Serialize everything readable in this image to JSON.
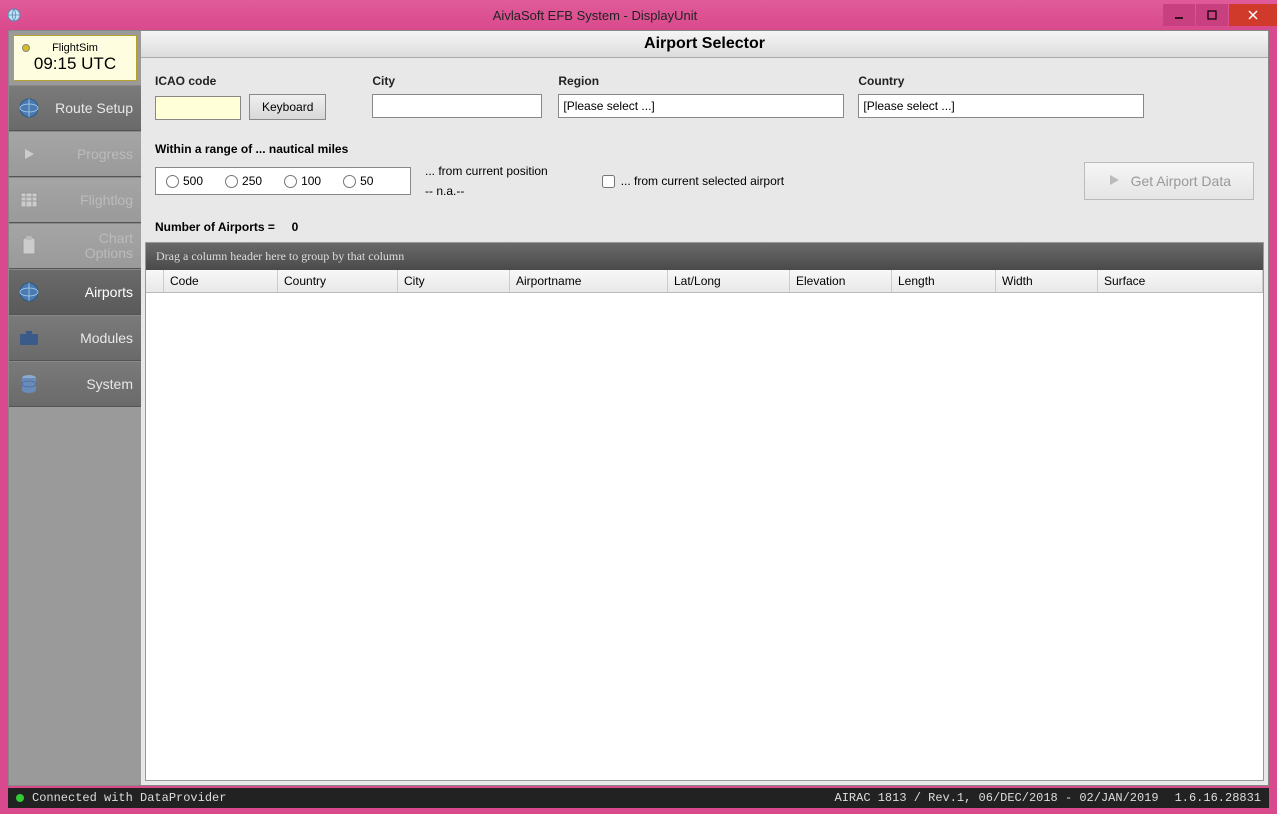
{
  "window": {
    "title": "AivlaSoft EFB System - DisplayUnit"
  },
  "clock": {
    "label": "FlightSim",
    "time": "09:15 UTC"
  },
  "nav": {
    "items": [
      {
        "label": "Route Setup",
        "enabled": true,
        "active": false,
        "icon": "globe"
      },
      {
        "label": "Progress",
        "enabled": false,
        "active": false,
        "icon": "play"
      },
      {
        "label": "Flightlog",
        "enabled": false,
        "active": false,
        "icon": "grid"
      },
      {
        "label": "Chart Options",
        "enabled": false,
        "active": false,
        "icon": "clipboard"
      },
      {
        "label": "Airports",
        "enabled": true,
        "active": true,
        "icon": "globe"
      },
      {
        "label": "Modules",
        "enabled": true,
        "active": false,
        "icon": "briefcase"
      },
      {
        "label": "System",
        "enabled": true,
        "active": false,
        "icon": "database"
      }
    ]
  },
  "page": {
    "title": "Airport Selector"
  },
  "filters": {
    "icao": {
      "label": "ICAO code",
      "value": "",
      "keyboard_btn": "Keyboard"
    },
    "city": {
      "label": "City",
      "value": ""
    },
    "region": {
      "label": "Region",
      "selected": "[Please select ...]"
    },
    "country": {
      "label": "Country",
      "selected": "[Please select ...]"
    }
  },
  "range": {
    "label": "Within a range of ... nautical miles",
    "options": [
      "500",
      "250",
      "100",
      "50"
    ],
    "from_position": "... from current position",
    "na": "-- n.a.--",
    "from_airport": "... from current selected airport",
    "from_airport_checked": false
  },
  "get_button": "Get Airport Data",
  "count": {
    "label": "Number of Airports =",
    "value": "0"
  },
  "grid": {
    "group_hint": "Drag a column header here to group by that column",
    "columns": [
      "Code",
      "Country",
      "City",
      "Airportname",
      "Lat/Long",
      "Elevation",
      "Length",
      "Width",
      "Surface"
    ],
    "rows": []
  },
  "status": {
    "left": "Connected with DataProvider",
    "airac": "AIRAC 1813 / Rev.1, 06/DEC/2018 - 02/JAN/2019",
    "version": "1.6.16.28831"
  }
}
